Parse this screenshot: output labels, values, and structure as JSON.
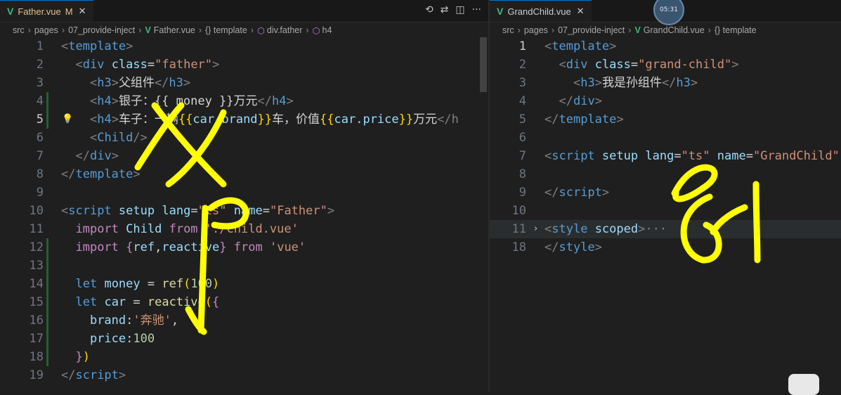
{
  "left_pane": {
    "tab": {
      "icon": "vue-icon",
      "filename": "Father.vue",
      "modified": "M",
      "close": "✕"
    },
    "actions": [
      "history-icon",
      "compare-icon",
      "split-editor-icon",
      "more-icon"
    ],
    "breadcrumb": [
      "src",
      "pages",
      "07_provide-inject",
      "Father.vue",
      "{} template",
      "div.father",
      "h4"
    ],
    "lines": [
      {
        "n": "1",
        "segs": [
          [
            "p",
            "<"
          ],
          [
            "t",
            "template"
          ],
          [
            "p",
            ">"
          ]
        ]
      },
      {
        "n": "2",
        "segs": [
          [
            "w",
            "  "
          ],
          [
            "p",
            "<"
          ],
          [
            "t",
            "div"
          ],
          [
            "w",
            " "
          ],
          [
            "a",
            "class"
          ],
          [
            "w",
            "="
          ],
          [
            "s",
            "\"father\""
          ],
          [
            "p",
            ">"
          ]
        ]
      },
      {
        "n": "3",
        "segs": [
          [
            "w",
            "    "
          ],
          [
            "p",
            "<"
          ],
          [
            "t",
            "h3"
          ],
          [
            "p",
            ">"
          ],
          [
            "w",
            "父组件"
          ],
          [
            "p",
            "</"
          ],
          [
            "t",
            "h3"
          ],
          [
            "p",
            ">"
          ]
        ]
      },
      {
        "n": "4",
        "segs": [
          [
            "w",
            "    "
          ],
          [
            "p",
            "<"
          ],
          [
            "t",
            "h4"
          ],
          [
            "p",
            ">"
          ],
          [
            "w",
            "银子：{{ money }}万元"
          ],
          [
            "p",
            "</"
          ],
          [
            "t",
            "h4"
          ],
          [
            "p",
            ">"
          ]
        ]
      },
      {
        "n": "5",
        "segs": [
          [
            "w",
            "    "
          ],
          [
            "p",
            "<"
          ],
          [
            "t",
            "h4"
          ],
          [
            "p",
            ">"
          ],
          [
            "w",
            "车子：一辆"
          ],
          [
            "bm",
            "{{"
          ],
          [
            "v",
            "car.brand"
          ],
          [
            "bm",
            "}}"
          ],
          [
            "w",
            "车，价值"
          ],
          [
            "bm",
            "{{"
          ],
          [
            "v",
            "car.price"
          ],
          [
            "bm",
            "}}"
          ],
          [
            "w",
            "万元"
          ],
          [
            "p",
            "</h"
          ]
        ]
      },
      {
        "n": "6",
        "segs": [
          [
            "w",
            "    "
          ],
          [
            "p",
            "<"
          ],
          [
            "t",
            "Child"
          ],
          [
            "p",
            "/>"
          ]
        ]
      },
      {
        "n": "7",
        "segs": [
          [
            "w",
            "  "
          ],
          [
            "p",
            "</"
          ],
          [
            "t",
            "div"
          ],
          [
            "p",
            ">"
          ]
        ]
      },
      {
        "n": "8",
        "segs": [
          [
            "p",
            "</"
          ],
          [
            "t",
            "template"
          ],
          [
            "p",
            ">"
          ]
        ]
      },
      {
        "n": "9",
        "segs": []
      },
      {
        "n": "10",
        "segs": [
          [
            "p",
            "<"
          ],
          [
            "t",
            "script"
          ],
          [
            "w",
            " "
          ],
          [
            "a",
            "setup"
          ],
          [
            "w",
            " "
          ],
          [
            "a",
            "lang"
          ],
          [
            "w",
            "="
          ],
          [
            "s",
            "\"ts\""
          ],
          [
            "w",
            " "
          ],
          [
            "a",
            "name"
          ],
          [
            "w",
            "="
          ],
          [
            "s",
            "\"Father\""
          ],
          [
            "p",
            ">"
          ]
        ]
      },
      {
        "n": "11",
        "segs": [
          [
            "w",
            "  "
          ],
          [
            "k",
            "import"
          ],
          [
            "w",
            " "
          ],
          [
            "v",
            "Child"
          ],
          [
            "w",
            " "
          ],
          [
            "k",
            "from"
          ],
          [
            "w",
            " "
          ],
          [
            "s",
            "'./Child.vue'"
          ]
        ]
      },
      {
        "n": "12",
        "segs": [
          [
            "w",
            "  "
          ],
          [
            "k",
            "import"
          ],
          [
            "w",
            " "
          ],
          [
            "k",
            "{"
          ],
          [
            "v",
            "ref"
          ],
          [
            "w",
            ","
          ],
          [
            "v",
            "reactive"
          ],
          [
            "k",
            "}"
          ],
          [
            "w",
            " "
          ],
          [
            "k",
            "from"
          ],
          [
            "w",
            " "
          ],
          [
            "s",
            "'vue'"
          ]
        ]
      },
      {
        "n": "13",
        "segs": []
      },
      {
        "n": "14",
        "segs": [
          [
            "w",
            "  "
          ],
          [
            "t",
            "let"
          ],
          [
            "w",
            " "
          ],
          [
            "v",
            "money"
          ],
          [
            "w",
            " = "
          ],
          [
            "f",
            "ref"
          ],
          [
            "bm",
            "("
          ],
          [
            "n",
            "100"
          ],
          [
            "bm",
            ")"
          ]
        ]
      },
      {
        "n": "15",
        "segs": [
          [
            "w",
            "  "
          ],
          [
            "t",
            "let"
          ],
          [
            "w",
            " "
          ],
          [
            "v",
            "car"
          ],
          [
            "w",
            " = "
          ],
          [
            "f",
            "reactive"
          ],
          [
            "bm",
            "("
          ],
          [
            "k",
            "{"
          ]
        ]
      },
      {
        "n": "16",
        "segs": [
          [
            "w",
            "    "
          ],
          [
            "v",
            "brand"
          ],
          [
            "w",
            ":"
          ],
          [
            "s",
            "'奔驰'"
          ],
          [
            "w",
            ","
          ]
        ]
      },
      {
        "n": "17",
        "segs": [
          [
            "w",
            "    "
          ],
          [
            "v",
            "price"
          ],
          [
            "w",
            ":"
          ],
          [
            "n",
            "100"
          ]
        ]
      },
      {
        "n": "18",
        "segs": [
          [
            "w",
            "  "
          ],
          [
            "k",
            "}"
          ],
          [
            "bm",
            ")"
          ]
        ]
      },
      {
        "n": "19",
        "segs": [
          [
            "p",
            "</"
          ],
          [
            "t",
            "script"
          ],
          [
            "p",
            ">"
          ]
        ]
      }
    ]
  },
  "right_pane": {
    "tab": {
      "icon": "vue-icon",
      "filename": "GrandChild.vue",
      "close": "✕"
    },
    "breadcrumb": [
      "src",
      "pages",
      "07_provide-inject",
      "GrandChild.vue",
      "{} template"
    ],
    "lines": [
      {
        "n": "1",
        "segs": [
          [
            "p",
            "<"
          ],
          [
            "t",
            "template"
          ],
          [
            "p",
            ">"
          ]
        ]
      },
      {
        "n": "2",
        "segs": [
          [
            "w",
            "  "
          ],
          [
            "p",
            "<"
          ],
          [
            "t",
            "div"
          ],
          [
            "w",
            " "
          ],
          [
            "a",
            "class"
          ],
          [
            "w",
            "="
          ],
          [
            "s",
            "\"grand-child\""
          ],
          [
            "p",
            ">"
          ]
        ]
      },
      {
        "n": "3",
        "segs": [
          [
            "w",
            "    "
          ],
          [
            "p",
            "<"
          ],
          [
            "t",
            "h3"
          ],
          [
            "p",
            ">"
          ],
          [
            "w",
            "我是孙组件"
          ],
          [
            "p",
            "</"
          ],
          [
            "t",
            "h3"
          ],
          [
            "p",
            ">"
          ]
        ]
      },
      {
        "n": "4",
        "segs": [
          [
            "w",
            "  "
          ],
          [
            "p",
            "</"
          ],
          [
            "t",
            "div"
          ],
          [
            "p",
            ">"
          ]
        ]
      },
      {
        "n": "5",
        "segs": [
          [
            "p",
            "</"
          ],
          [
            "t",
            "template"
          ],
          [
            "p",
            ">"
          ]
        ]
      },
      {
        "n": "6",
        "segs": []
      },
      {
        "n": "7",
        "segs": [
          [
            "p",
            "<"
          ],
          [
            "t",
            "script"
          ],
          [
            "w",
            " "
          ],
          [
            "a",
            "setup"
          ],
          [
            "w",
            " "
          ],
          [
            "a",
            "lang"
          ],
          [
            "w",
            "="
          ],
          [
            "s",
            "\"ts\""
          ],
          [
            "w",
            " "
          ],
          [
            "a",
            "name"
          ],
          [
            "w",
            "="
          ],
          [
            "s",
            "\"GrandChild\""
          ]
        ]
      },
      {
        "n": "8",
        "segs": []
      },
      {
        "n": "9",
        "segs": [
          [
            "p",
            "</"
          ],
          [
            "t",
            "script"
          ],
          [
            "p",
            ">"
          ]
        ]
      },
      {
        "n": "10",
        "segs": []
      },
      {
        "n": "11",
        "segs": [
          [
            "p",
            "<"
          ],
          [
            "t",
            "style"
          ],
          [
            "w",
            " "
          ],
          [
            "a",
            "scoped"
          ],
          [
            "p",
            ">"
          ],
          [
            "p",
            "···"
          ]
        ]
      },
      {
        "n": "18",
        "segs": [
          [
            "p",
            "</"
          ],
          [
            "t",
            "style"
          ],
          [
            "p",
            ">"
          ]
        ]
      }
    ]
  },
  "clock_text": "05:31",
  "colors": {
    "accent": "#0078d4",
    "ink": "#ffff00",
    "vue_green": "#41b883"
  }
}
